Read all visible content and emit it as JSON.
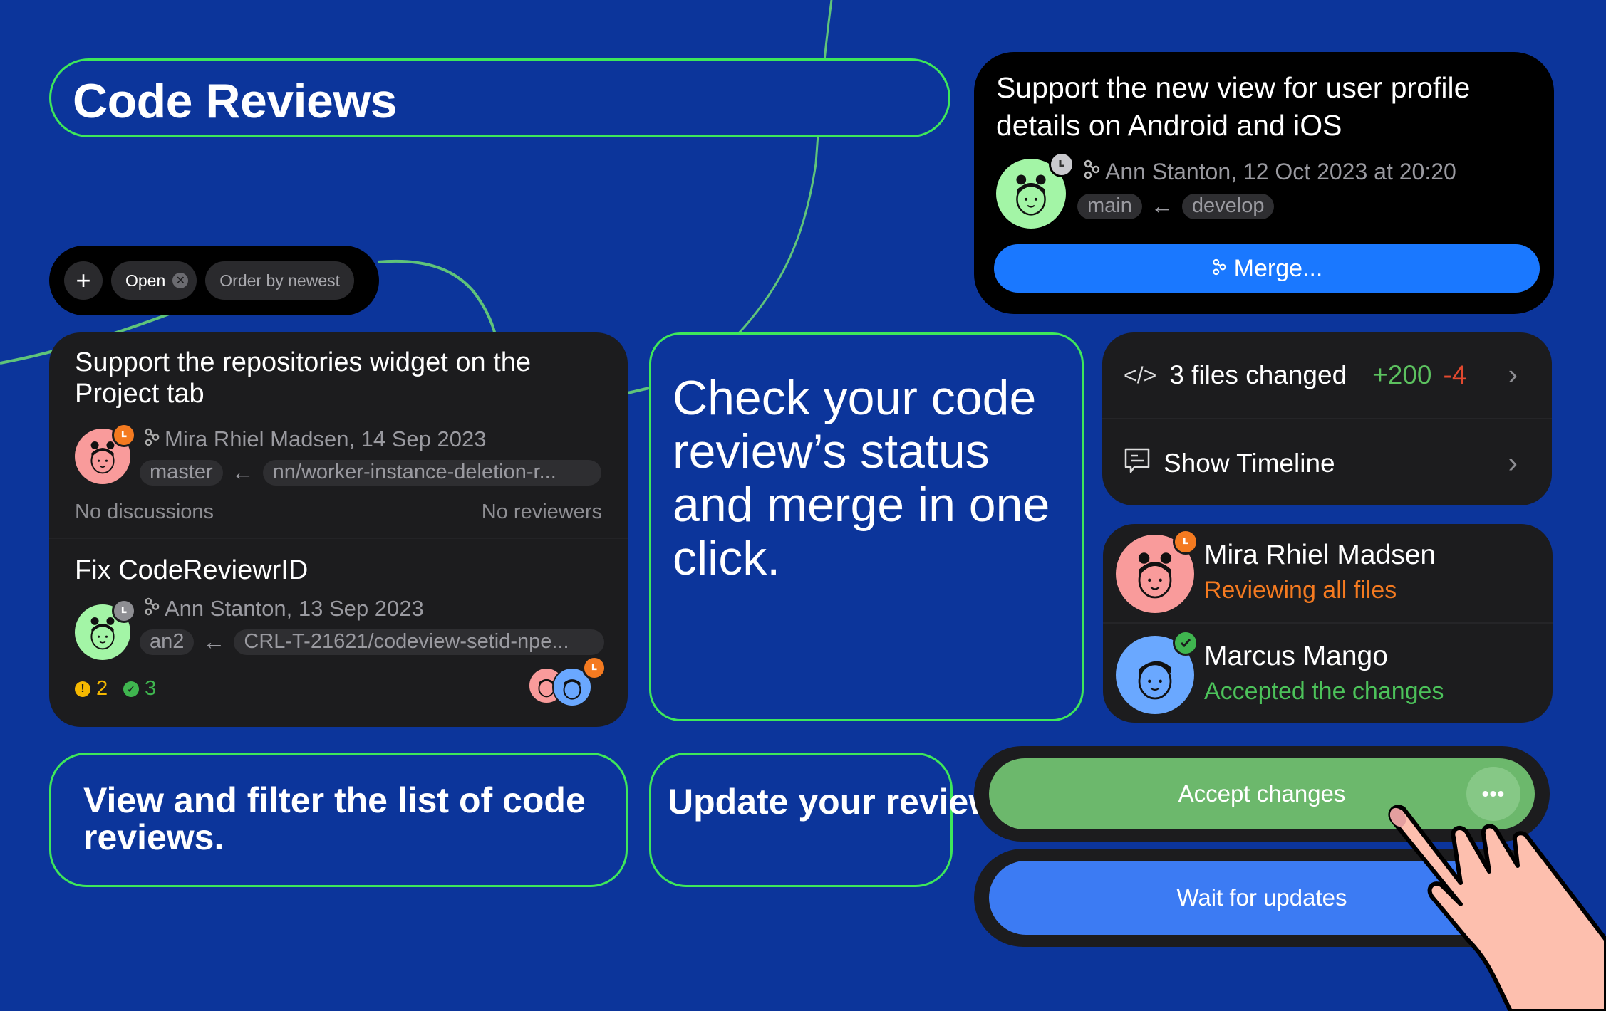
{
  "header": {
    "title": "Code Reviews"
  },
  "merge_card": {
    "title": "Support the new view for user profile details on Android and iOS",
    "author_meta": "Ann Stanton, 12 Oct 2023 at 20:20",
    "target_branch": "main",
    "source_branch": "develop",
    "merge_button": "Merge...",
    "author_avatar_color": "#a3f5a6",
    "status_badge": "clock-icon"
  },
  "filter_bar": {
    "add_label": "+",
    "chips": [
      {
        "label": "Open",
        "removable": true
      },
      {
        "label": "Order by newest",
        "removable": false
      }
    ]
  },
  "review_list": [
    {
      "title": "Support the repositories widget on the Project tab",
      "author_meta": "Mira Rhiel Madsen, 14 Sep 2023",
      "target_branch": "master",
      "source_branch": "nn/worker-instance-deletion-r...",
      "discussions": "No discussions",
      "reviewers": "No reviewers",
      "avatar_color": "#f99b9b",
      "badge": "clock-icon",
      "badge_color": "#f47a20"
    },
    {
      "title": "Fix CodeReviewrID",
      "author_meta": "Ann Stanton, 13 Sep 2023",
      "target_branch": "an2",
      "source_branch": "CRL-T-21621/codeview-setid-npe...",
      "warnings_count": "2",
      "approvals_count": "3",
      "avatar_color": "#a3f5a6",
      "badge": "clock-icon",
      "badge_color": "#8e8e93"
    }
  ],
  "callouts": {
    "check": "Check your code review’s status and merge in one click.",
    "view": "View and filter the list of code reviews.",
    "update": "Update your review’s status."
  },
  "changes_card": {
    "files_label": "3 files changed",
    "additions": "+200",
    "deletions": "-4",
    "timeline_label": "Show Timeline"
  },
  "reviewers": [
    {
      "name": "Mira Rhiel Madsen",
      "status": "Reviewing all files",
      "status_color": "#f47a20",
      "avatar_color": "#f99b9b",
      "badge": "clock-icon"
    },
    {
      "name": "Marcus Mango",
      "status": "Accepted the changes",
      "status_color": "#4cc25a",
      "avatar_color": "#6aa8ff",
      "badge": "check-icon"
    }
  ],
  "actions": {
    "accept": "Accept changes",
    "more": "•••",
    "wait": "Wait for updates"
  },
  "colors": {
    "background": "#0c359b",
    "outline": "#3ee85a",
    "merge_blue": "#1a78ff",
    "accept_green": "#6cb86c",
    "wait_blue": "#3c7bf3",
    "card_dark": "#1c1c1e"
  }
}
